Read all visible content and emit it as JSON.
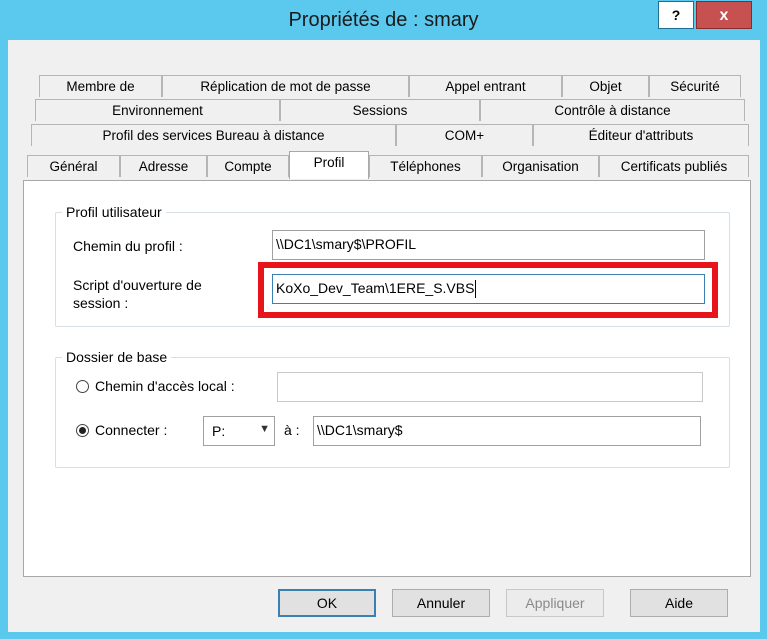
{
  "window": {
    "title": "Propriétés de : smary"
  },
  "titlebar": {
    "help_label": "?",
    "close_label": "x"
  },
  "tabs": {
    "row1": [
      "Membre de",
      "Réplication de mot de passe",
      "Appel entrant",
      "Objet",
      "Sécurité"
    ],
    "row2": [
      "Environnement",
      "Sessions",
      "Contrôle à distance"
    ],
    "row3": [
      "Profil des services Bureau à distance",
      "COM+",
      "Éditeur d'attributs"
    ],
    "row4": [
      "Général",
      "Adresse",
      "Compte",
      "Profil",
      "Téléphones",
      "Organisation",
      "Certificats publiés"
    ],
    "active": "Profil"
  },
  "profile": {
    "group_label": "Profil utilisateur",
    "path_label": "Chemin du profil :",
    "path_value": "\\\\DC1\\smary$\\PROFIL",
    "script_label_line1": "Script d'ouverture de",
    "script_label_line2": "session :",
    "script_value": "KoXo_Dev_Team\\1ERE_S.VBS"
  },
  "home": {
    "group_label": "Dossier de base",
    "local_label": "Chemin d'accès local :",
    "local_value": "",
    "connect_label": "Connecter :",
    "drive_value": "P:",
    "to_label": "à :",
    "connect_value": "\\\\DC1\\smary$",
    "selected": "connect"
  },
  "buttons": {
    "ok": "OK",
    "cancel": "Annuler",
    "apply": "Appliquer",
    "help": "Aide"
  },
  "colors": {
    "titlebar": "#5bc8ee",
    "close": "#c75050",
    "highlight": "#e8141b"
  }
}
